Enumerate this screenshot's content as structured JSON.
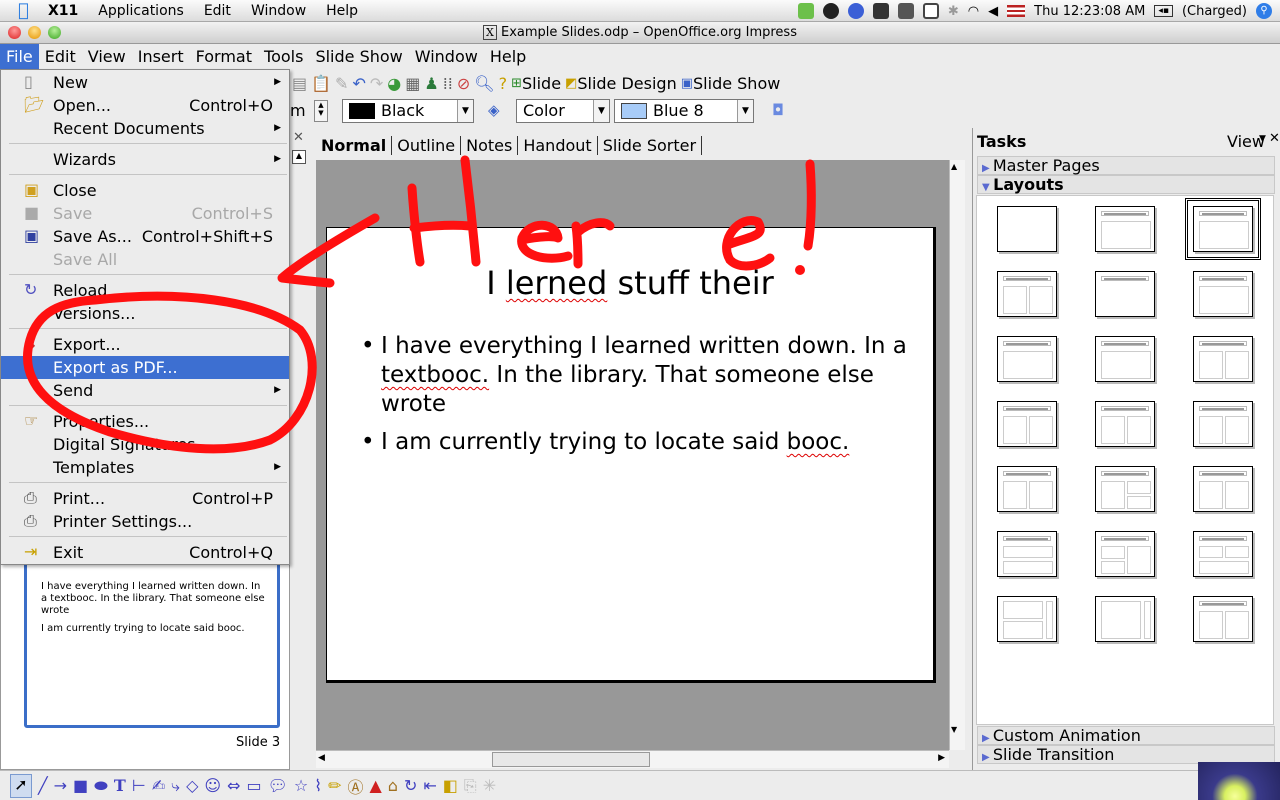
{
  "mac_menubar": {
    "app_name": "X11",
    "items": [
      "Applications",
      "Edit",
      "Window",
      "Help"
    ],
    "clock": "Thu 12:23:08 AM",
    "battery": "(Charged)"
  },
  "window": {
    "title": "Example Slides.odp – OpenOffice.org Impress"
  },
  "app_menu": {
    "items": [
      "File",
      "Edit",
      "View",
      "Insert",
      "Format",
      "Tools",
      "Slide Show",
      "Window",
      "Help"
    ],
    "active": "File"
  },
  "toolbar": {
    "slide_label": "Slide",
    "slide_design_label": "Slide Design",
    "slide_show_label": "Slide Show"
  },
  "format_bar": {
    "line_width_partial": "m",
    "line_color": "Black",
    "area_style": "Color",
    "area_color": "Blue 8",
    "line_color_swatch": "#000000",
    "area_color_swatch": "#a8ccf8"
  },
  "file_menu": {
    "items": [
      {
        "label": "New",
        "shortcut": "",
        "submenu": true,
        "disabled": false,
        "icon": "new-document-icon"
      },
      {
        "label": "Open...",
        "shortcut": "Control+O",
        "submenu": false,
        "disabled": false,
        "icon": "open-folder-icon"
      },
      {
        "label": "Recent Documents",
        "shortcut": "",
        "submenu": true,
        "disabled": false,
        "icon": ""
      },
      {
        "label": "Wizards",
        "shortcut": "",
        "submenu": true,
        "disabled": false,
        "icon": ""
      },
      {
        "label": "Close",
        "shortcut": "",
        "submenu": false,
        "disabled": false,
        "icon": "close-document-icon"
      },
      {
        "label": "Save",
        "shortcut": "Control+S",
        "submenu": false,
        "disabled": true,
        "icon": "save-icon"
      },
      {
        "label": "Save As...",
        "shortcut": "Control+Shift+S",
        "submenu": false,
        "disabled": false,
        "icon": "save-as-icon"
      },
      {
        "label": "Save All",
        "shortcut": "",
        "submenu": false,
        "disabled": true,
        "icon": ""
      },
      {
        "label": "Reload",
        "shortcut": "",
        "submenu": false,
        "disabled": false,
        "icon": "reload-icon"
      },
      {
        "label": "Versions...",
        "shortcut": "",
        "submenu": false,
        "disabled": false,
        "icon": ""
      },
      {
        "label": "Export...",
        "shortcut": "",
        "submenu": false,
        "disabled": false,
        "icon": "export-icon"
      },
      {
        "label": "Export as PDF...",
        "shortcut": "",
        "submenu": false,
        "disabled": false,
        "icon": "",
        "highlighted": true
      },
      {
        "label": "Send",
        "shortcut": "",
        "submenu": true,
        "disabled": false,
        "icon": ""
      },
      {
        "label": "Properties...",
        "shortcut": "",
        "submenu": false,
        "disabled": false,
        "icon": "properties-icon"
      },
      {
        "label": "Digital Signatures...",
        "shortcut": "",
        "submenu": false,
        "disabled": false,
        "icon": ""
      },
      {
        "label": "Templates",
        "shortcut": "",
        "submenu": true,
        "disabled": false,
        "icon": ""
      },
      {
        "label": "Print...",
        "shortcut": "Control+P",
        "submenu": false,
        "disabled": false,
        "icon": "print-icon"
      },
      {
        "label": "Printer Settings...",
        "shortcut": "",
        "submenu": false,
        "disabled": false,
        "icon": "printer-settings-icon"
      },
      {
        "label": "Exit",
        "shortcut": "Control+Q",
        "submenu": false,
        "disabled": false,
        "icon": "exit-icon"
      }
    ]
  },
  "view_tabs": [
    "Normal",
    "Outline",
    "Notes",
    "Handout",
    "Slide Sorter"
  ],
  "active_view_tab": "Normal",
  "slide": {
    "title_word1": "I ",
    "title_misspelled": "lerned",
    "title_rest": " stuff their",
    "bullet1_part1": "I have everything I learned written down. In a ",
    "bullet1_misspelled": "textbooc.",
    "bullet1_part2": " In the library. That someone else wrote",
    "bullet2_part1": "I am currently trying to locate said ",
    "bullet2_misspelled": "booc."
  },
  "slide_panel": {
    "thumb_bullets": [
      "I have everything I learned written down. In a textbooc. In the library. That someone else wrote",
      "I am currently trying to locate said booc."
    ],
    "slide_label": "Slide 3"
  },
  "tasks_pane": {
    "title": "Tasks",
    "view_label": "View",
    "sections": {
      "master_pages": "Master Pages",
      "layouts": "Layouts",
      "custom_animation": "Custom Animation",
      "slide_transition": "Slide Transition"
    },
    "layouts": [
      "Blank Slide",
      "Title Only",
      "Title, Content",
      "Title and 2 Content",
      "Title Slide",
      "Centered Text",
      "Title, Chart",
      "Title, Table",
      "Title, Clipart and Text",
      "Title, Text and Chart",
      "Title, Text and Clipart",
      "Title, Chart and Text",
      "Title, Text, Object",
      "Title, Text and 2 Objects",
      "Title, Object and Text",
      "Title, Object over Text",
      "Title, 2 Objects and Text",
      "Title, 2 Objects over Text",
      "Vertical Title, Text, Chart",
      "Title, Vertical Text",
      "Title, Vertical Text, Clipart"
    ],
    "selected_layout_index": 2
  },
  "annotation": {
    "text": "Here!",
    "color": "#ff1010"
  }
}
